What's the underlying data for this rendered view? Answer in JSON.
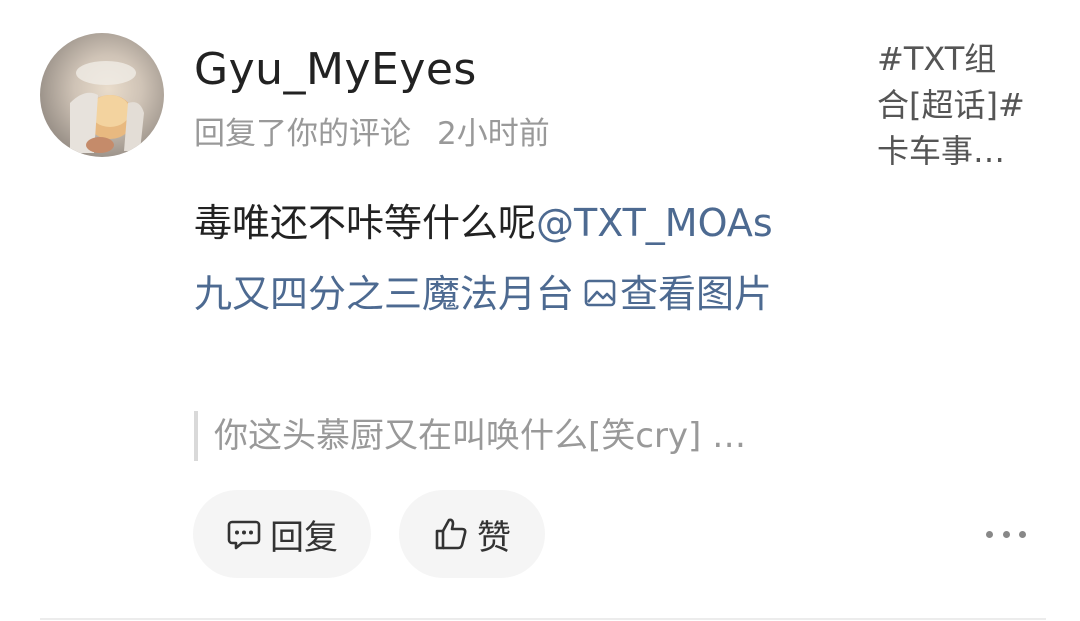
{
  "notification": {
    "username": "Gyu_MyEyes",
    "action": "回复了你的评论",
    "time": "2小时前",
    "topic": "#TXT组\n合[超话]#\n卡车事…",
    "body_text": "毒唯还不咔等什么呢",
    "mention": "@TXT_MOAs",
    "location_link": "九又四分之三魔法月台",
    "view_image_label": "查看图片",
    "quote": "你这头慕厨又在叫唤什么[笑cry] …",
    "reply_label": "回复",
    "like_label": "赞"
  },
  "icons": {
    "avatar": "avatar-photo",
    "image": "image-icon",
    "reply": "comment-icon",
    "like": "thumbs-up-icon",
    "more": "more-dots-icon"
  },
  "colors": {
    "link": "#4d6a91",
    "text": "#222222",
    "muted": "#999999",
    "button_bg": "#f5f5f5"
  }
}
